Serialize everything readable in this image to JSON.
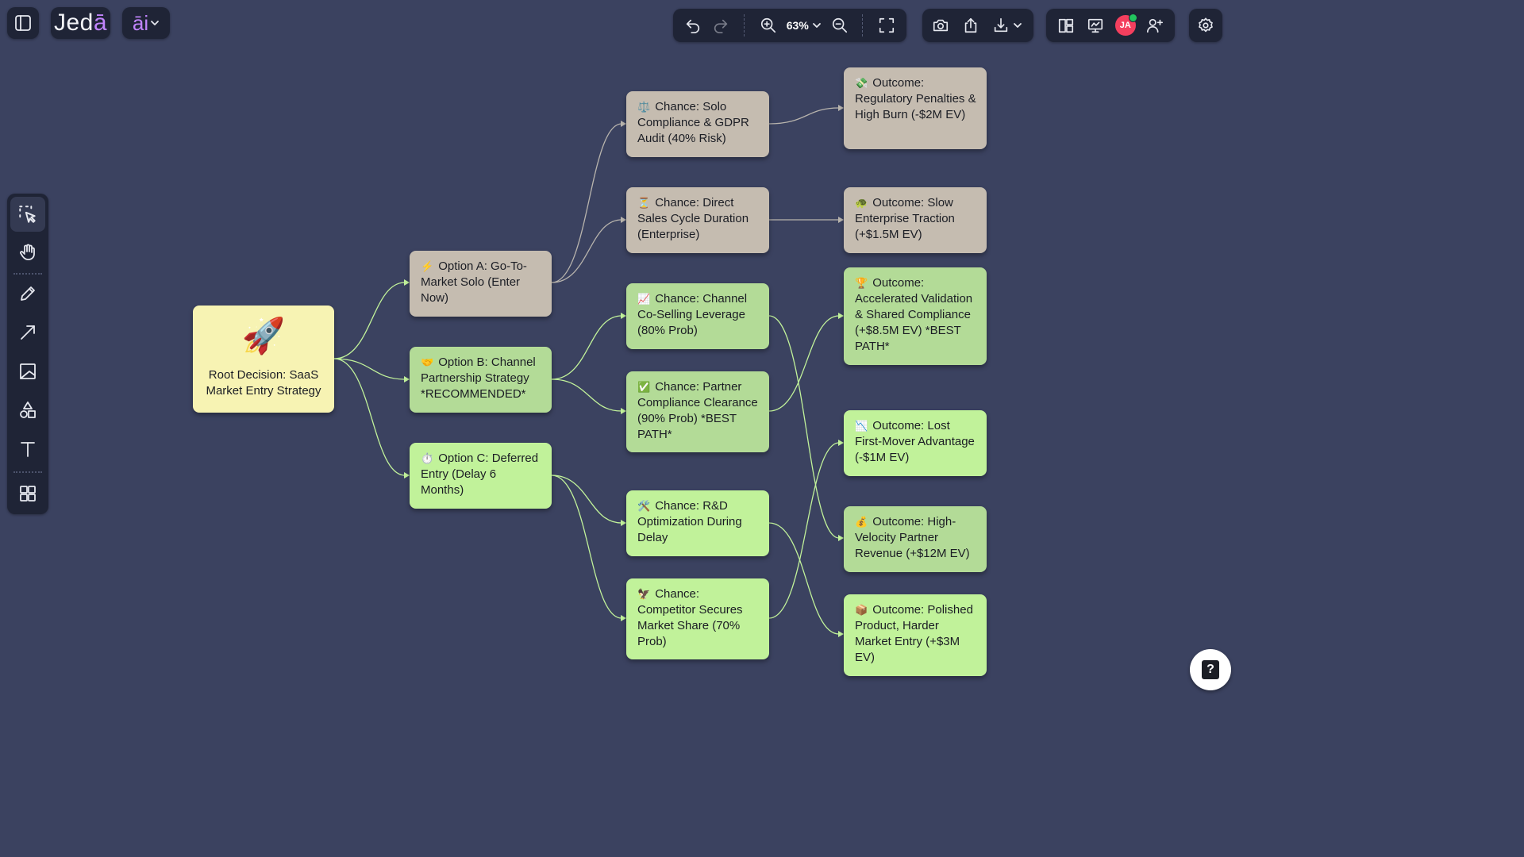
{
  "app": {
    "logo_text": "Jed",
    "logo_accent": "ā",
    "ai_label": "āi"
  },
  "toolbar": {
    "zoom": "63%"
  },
  "user": {
    "initials": "JA"
  },
  "colors": {
    "canvas": "#3b4260",
    "toolbar": "#1f2436",
    "node_gray": "#c5bcb0",
    "node_light_green": "#b3db97",
    "node_bright_green": "#c1f29a",
    "node_root": "#f7f3b3",
    "edge_gray": "#b8b4ad",
    "edge_green": "#c1f29a",
    "accent": "#c084fc"
  },
  "icons": {
    "top": [
      "sidebar-toggle-icon",
      "undo-icon",
      "redo-icon",
      "zoom-in-icon",
      "chevron-down-icon",
      "zoom-out-icon",
      "fit-screen-icon",
      "camera-icon",
      "upload-icon",
      "download-icon",
      "layout-icon",
      "presentation-icon",
      "add-user-icon",
      "gear-icon"
    ],
    "left": [
      "select-icon",
      "hand-icon",
      "pencil-icon",
      "arrow-icon",
      "image-icon",
      "shapes-icon",
      "text-icon",
      "grid-icon"
    ]
  },
  "diagram": {
    "root": {
      "emoji": "🚀",
      "label": "Root Decision: SaaS Market Entry Strategy"
    },
    "options": [
      {
        "emoji": "⚡",
        "label": "Option A: Go-To-Market Solo (Enter Now)"
      },
      {
        "emoji": "🤝",
        "label": "Option B: Channel Partnership Strategy *RECOMMENDED*"
      },
      {
        "emoji": "⏱️",
        "label": "Option C: Deferred Entry (Delay 6 Months)"
      }
    ],
    "chances": [
      {
        "emoji": "⚖️",
        "label": "Chance: Solo Compliance & GDPR Audit (40% Risk)"
      },
      {
        "emoji": "⏳",
        "label": "Chance: Direct Sales Cycle Duration (Enterprise)"
      },
      {
        "emoji": "📈",
        "label": "Chance: Channel Co-Selling Leverage (80% Prob)"
      },
      {
        "emoji": "✅",
        "label": "Chance: Partner Compliance Clearance (90% Prob) *BEST PATH*"
      },
      {
        "emoji": "🛠️",
        "label": "Chance: R&D Optimization During Delay"
      },
      {
        "emoji": "🦅",
        "label": "Chance: Competitor Secures Market Share (70% Prob)"
      }
    ],
    "outcomes": [
      {
        "emoji": "💸",
        "label": "Outcome: Regulatory Penalties & High Burn (-$2M EV)"
      },
      {
        "emoji": "🐢",
        "label": "Outcome: Slow Enterprise Traction (+$1.5M EV)"
      },
      {
        "emoji": "🏆",
        "label": "Outcome: Accelerated Validation & Shared Compliance (+$8.5M EV) *BEST PATH*"
      },
      {
        "emoji": "📉",
        "label": "Outcome: Lost First-Mover Advantage (-$1M EV)"
      },
      {
        "emoji": "💰",
        "label": "Outcome: High-Velocity Partner Revenue (+$12M EV)"
      },
      {
        "emoji": "📦",
        "label": "Outcome: Polished Product, Harder Market Entry (+$3M EV)"
      }
    ]
  }
}
